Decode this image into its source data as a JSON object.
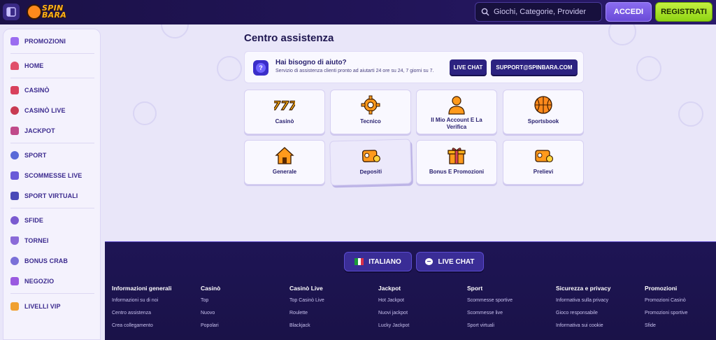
{
  "header": {
    "logo_text_1": "SPIN",
    "logo_text_2": "BARA",
    "search_placeholder": "Giochi, Categorie, Provider",
    "login_label": "ACCEDI",
    "register_label": "REGISTRATI"
  },
  "sidebar": {
    "items": [
      {
        "label": "PROMOZIONI",
        "icon": "gift-icon",
        "color": "#9b6cf0"
      },
      {
        "label": "HOME",
        "icon": "home-icon",
        "color": "#e0506a"
      },
      {
        "label": "CASINÒ",
        "icon": "casino-icon",
        "color": "#d8405c"
      },
      {
        "label": "CASINÒ LIVE",
        "icon": "live-casino-icon",
        "color": "#c83a52"
      },
      {
        "label": "JACKPOT",
        "icon": "jackpot-icon",
        "color": "#c04a8a"
      },
      {
        "label": "SPORT",
        "icon": "sport-icon",
        "color": "#5a6ad8"
      },
      {
        "label": "SCOMMESSE LIVE",
        "icon": "live-bets-icon",
        "color": "#6a5ad8"
      },
      {
        "label": "SPORT VIRTUALI",
        "icon": "virtual-sport-icon",
        "color": "#4a4ab8"
      },
      {
        "label": "SFIDE",
        "icon": "challenge-icon",
        "color": "#7a5ad0"
      },
      {
        "label": "TORNEI",
        "icon": "trophy-icon",
        "color": "#8a6ad8"
      },
      {
        "label": "BONUS CRAB",
        "icon": "crab-icon",
        "color": "#7a70d8"
      },
      {
        "label": "NEGOZIO",
        "icon": "shop-icon",
        "color": "#9a5ae0"
      },
      {
        "label": "LIVELLI VIP",
        "icon": "crown-icon",
        "color": "#f0a030"
      }
    ]
  },
  "main": {
    "title": "Centro assistenza",
    "help": {
      "title": "Hai bisogno di aiuto?",
      "subtitle": "Servizio di assistenza clienti pronto ad aiutarti 24 ore su 24, 7 giorni su 7.",
      "live_chat_label": "LIVE CHAT",
      "email_label": "SUPPORT@SPINBARA.COM"
    },
    "cards": [
      {
        "label": "Casinò",
        "icon": "slot-777-icon"
      },
      {
        "label": "Tecnico",
        "icon": "gear-icon"
      },
      {
        "label": "Il Mio Account E La Verifica",
        "icon": "user-icon"
      },
      {
        "label": "Sportsbook",
        "icon": "basketball-icon"
      },
      {
        "label": "Generale",
        "icon": "house-icon"
      },
      {
        "label": "Depositi",
        "icon": "wallet-in-icon"
      },
      {
        "label": "Bonus E Promozioni",
        "icon": "gift-icon"
      },
      {
        "label": "Prelievi",
        "icon": "wallet-out-icon"
      }
    ]
  },
  "footer": {
    "language_label": "ITALIANO",
    "live_chat_label": "LIVE CHAT",
    "columns": [
      {
        "heading": "Informazioni generali",
        "links": [
          "Informazioni su di noi",
          "Centro assistenza",
          "Crea collegamento"
        ]
      },
      {
        "heading": "Casinò",
        "links": [
          "Top",
          "Nuovo",
          "Popolari"
        ]
      },
      {
        "heading": "Casinò Live",
        "links": [
          "Top Casinò Live",
          "Roulette",
          "Blackjack"
        ]
      },
      {
        "heading": "Jackpot",
        "links": [
          "Hot Jackpot",
          "Nuovi jackpot",
          "Lucky Jackpot"
        ]
      },
      {
        "heading": "Sport",
        "links": [
          "Scommesse sportive",
          "Scommesse live",
          "Sport virtuali"
        ]
      },
      {
        "heading": "Sicurezza e privacy",
        "links": [
          "Informativa sulla privacy",
          "Gioco responsabile",
          "Informativa sui cookie"
        ]
      },
      {
        "heading": "Promozioni",
        "links": [
          "Promozioni Casinò",
          "Promozioni sportive",
          "Sfide"
        ]
      }
    ]
  }
}
